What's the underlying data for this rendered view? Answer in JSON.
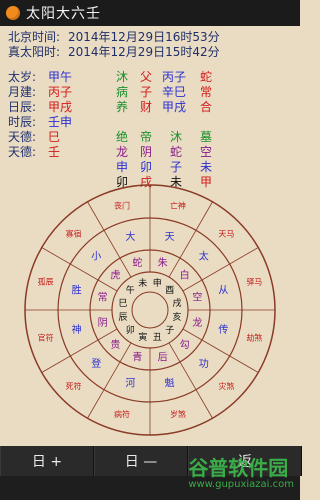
{
  "app": {
    "title": "太阳大六壬"
  },
  "time": {
    "beijing_label": "北京时间:",
    "beijing_value": "2014年12月29日16时53分",
    "solar_label": "真太阳时:",
    "solar_value": "2014年12月29日15时42分"
  },
  "pillars": [
    {
      "label": "太岁:",
      "value": "甲午"
    },
    {
      "label": "月建:",
      "value": "丙子"
    },
    {
      "label": "日辰:",
      "value": "甲戌"
    },
    {
      "label": "时辰:",
      "value": "壬申"
    },
    {
      "label": "天德:",
      "value": "巳"
    },
    {
      "label": "天德:",
      "value": "壬"
    }
  ],
  "grid": {
    "rows": [
      [
        "沐",
        "父",
        "丙子",
        "蛇"
      ],
      [
        "病",
        "子",
        "辛巳",
        "常"
      ],
      [
        "养",
        "财",
        "甲戌",
        "合"
      ],
      [
        "",
        "",
        "",
        ""
      ],
      [
        "绝",
        "帝",
        "沐",
        "墓"
      ],
      [
        "龙",
        "阴",
        "蛇",
        "空"
      ],
      [
        "申",
        "卯",
        "子",
        "未"
      ],
      [
        "卯",
        "戌",
        "未",
        "甲"
      ]
    ]
  },
  "wheel": {
    "center": [
      "申",
      "酉",
      "戌",
      "亥",
      "子",
      "丑",
      "寅",
      "卯",
      "辰",
      "巳",
      "午",
      "未"
    ],
    "inner": [
      "朱",
      "白",
      "空",
      "龙",
      "勾",
      "后",
      "青",
      "贵",
      "阴",
      "常",
      "虎",
      "蛇"
    ],
    "mid": [
      "天",
      "太",
      "从",
      "传",
      "功",
      "魁",
      "河",
      "登",
      "神",
      "胜",
      "小",
      "大"
    ],
    "outer": [
      "亡神",
      "天马",
      "驿马",
      "劫煞",
      "灾煞",
      "岁煞",
      "病符",
      "死符",
      "官符",
      "孤辰",
      "寡宿",
      "丧门"
    ]
  },
  "buttons": {
    "prev_day": "日 +",
    "next_day": "日 —",
    "back": "返"
  },
  "watermark": {
    "brand": "谷普软件园",
    "url": "www.gupuxiazai.com"
  }
}
